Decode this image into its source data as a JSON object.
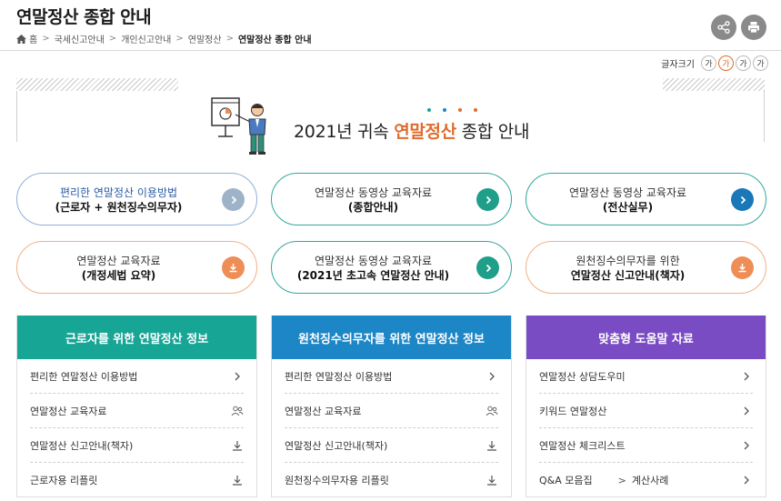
{
  "header": {
    "title": "연말정산 종합 안내",
    "breadcrumb": [
      "홈",
      "국세신고안내",
      "개인신고안내",
      "연말정산",
      "연말정산 종합 안내"
    ]
  },
  "fontsize": {
    "label": "글자크기",
    "buttons": [
      "가",
      "가",
      "가",
      "가"
    ]
  },
  "banner": {
    "title_prefix": "2021년 귀속 ",
    "title_highlight": "연말정산",
    "title_suffix": " 종합 안내"
  },
  "quick_links": [
    {
      "line1": "편리한 연말정산 이용방법",
      "line2": "(근로자 + 원천징수의무자)",
      "icon": "chevron-right-icon",
      "color": "#9fb3c8"
    },
    {
      "line1": "연말정산 동영상 교육자료",
      "line2": "(종합안내)",
      "icon": "chevron-right-icon",
      "color": "#1f9e8a"
    },
    {
      "line1": "연말정산 동영상 교육자료",
      "line2": "(전산실무)",
      "icon": "chevron-right-icon",
      "color": "#1b78b8"
    },
    {
      "line1": "연말정산 교육자료",
      "line2": "(개정세법 요약)",
      "icon": "download-icon",
      "color": "#ef8d56"
    },
    {
      "line1": "연말정산 동영상 교육자료",
      "line2": "(2021년 초고속 연말정산 안내)",
      "icon": "chevron-right-icon",
      "color": "#1f9e8a"
    },
    {
      "line1": "원천징수의무자를 위한",
      "line2": "연말정산 신고안내(책자)",
      "icon": "download-icon",
      "color": "#ef8d56"
    }
  ],
  "panels": [
    {
      "title": "근로자를 위한 연말정산 정보",
      "color": "#17a595",
      "items": [
        {
          "label": "편리한 연말정산 이용방법",
          "icon": "chevron-right-icon"
        },
        {
          "label": "연말정산 교육자료",
          "icon": "people-icon"
        },
        {
          "label": "연말정산 신고안내(책자)",
          "icon": "download-icon"
        },
        {
          "label": "근로자용 리플릿",
          "icon": "download-icon"
        }
      ]
    },
    {
      "title": "원천징수의무자를 위한 연말정산 정보",
      "color": "#1c86c6",
      "items": [
        {
          "label": "편리한 연말정산 이용방법",
          "icon": "chevron-right-icon"
        },
        {
          "label": "연말정산 교육자료",
          "icon": "people-icon"
        },
        {
          "label": "연말정산 신고안내(책자)",
          "icon": "download-icon"
        },
        {
          "label": "원천징수의무자용 리플릿",
          "icon": "download-icon"
        }
      ]
    },
    {
      "title": "맞춤형 도움말 자료",
      "color": "#7a4cc4",
      "items": [
        {
          "label": "연말정산 상담도우미",
          "icon": "chevron-right-icon"
        },
        {
          "label": "키워드 연말정산",
          "icon": "chevron-right-icon"
        },
        {
          "label": "연말정산 체크리스트",
          "icon": "chevron-right-icon"
        },
        {
          "label": "Q&A 모음집",
          "extra": "계산사례",
          "icon": "chevron-right-icon"
        }
      ]
    }
  ]
}
